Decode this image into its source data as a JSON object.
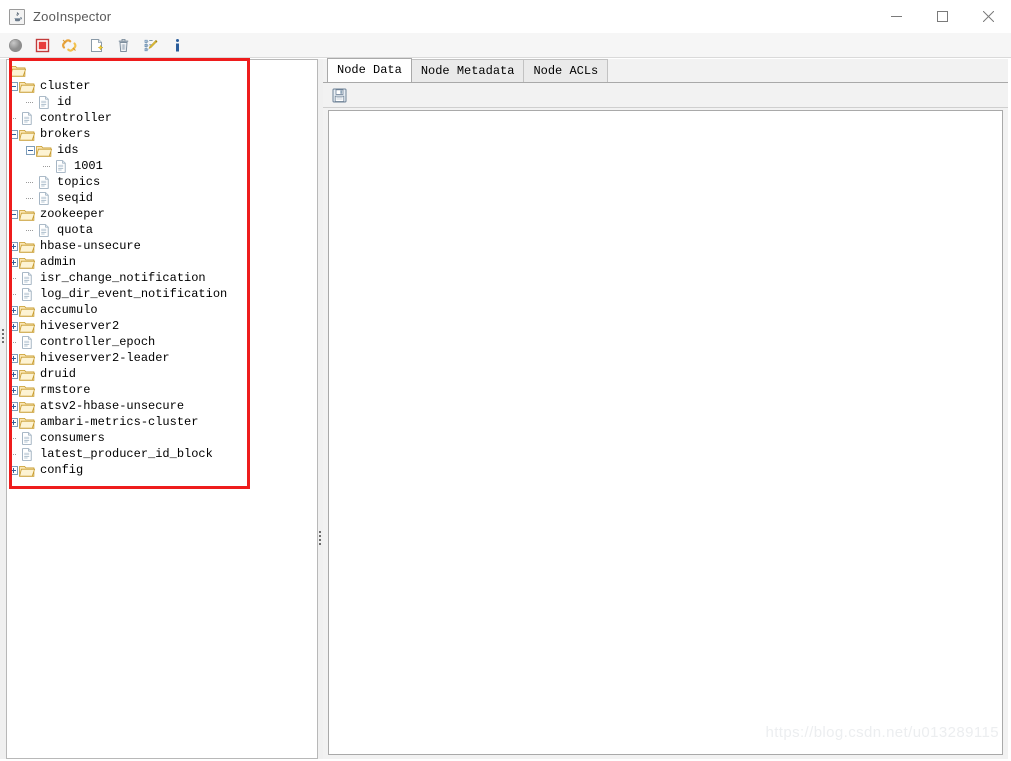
{
  "window": {
    "title": "ZooInspector",
    "app_icon": "java-coffee-cup-icon",
    "controls": {
      "minimize": "—",
      "maximize": "□",
      "close": "✕"
    }
  },
  "toolbar": {
    "buttons": [
      {
        "name": "connect-button",
        "icon": "gray-circle-icon",
        "label": "Connect",
        "enabled": false
      },
      {
        "name": "disconnect-button",
        "icon": "red-square-icon",
        "label": "Disconnect",
        "enabled": true
      },
      {
        "name": "reconnect-button",
        "icon": "yellow-links-icon",
        "label": "Reconnect",
        "enabled": true
      },
      {
        "name": "add-node-button",
        "icon": "new-page-icon",
        "label": "Add Node",
        "enabled": true
      },
      {
        "name": "delete-node-button",
        "icon": "trash-can-icon",
        "label": "Delete Node",
        "enabled": true
      },
      {
        "name": "edit-node-button",
        "icon": "tree-pencil-icon",
        "label": "Edit Node",
        "enabled": true
      },
      {
        "name": "about-button",
        "icon": "info-icon",
        "label": "About",
        "enabled": true
      }
    ]
  },
  "tree": {
    "root": {
      "label": "",
      "icon": "folder-open-icon"
    },
    "nodes": [
      {
        "label": "cluster",
        "icon": "folder-open-icon",
        "depth": 1,
        "toggle": "minus"
      },
      {
        "label": "id",
        "icon": "file-icon",
        "depth": 2,
        "toggle": "none"
      },
      {
        "label": "controller",
        "icon": "file-icon",
        "depth": 1,
        "toggle": "none"
      },
      {
        "label": "brokers",
        "icon": "folder-open-icon",
        "depth": 1,
        "toggle": "minus"
      },
      {
        "label": "ids",
        "icon": "folder-open-icon",
        "depth": 2,
        "toggle": "minus"
      },
      {
        "label": "1001",
        "icon": "file-icon",
        "depth": 3,
        "toggle": "none"
      },
      {
        "label": "topics",
        "icon": "file-icon",
        "depth": 2,
        "toggle": "none"
      },
      {
        "label": "seqid",
        "icon": "file-icon",
        "depth": 2,
        "toggle": "none"
      },
      {
        "label": "zookeeper",
        "icon": "folder-open-icon",
        "depth": 1,
        "toggle": "minus"
      },
      {
        "label": "quota",
        "icon": "file-icon",
        "depth": 2,
        "toggle": "none"
      },
      {
        "label": "hbase-unsecure",
        "icon": "folder-open-icon",
        "depth": 1,
        "toggle": "plus"
      },
      {
        "label": "admin",
        "icon": "folder-open-icon",
        "depth": 1,
        "toggle": "plus"
      },
      {
        "label": "isr_change_notification",
        "icon": "file-icon",
        "depth": 1,
        "toggle": "none"
      },
      {
        "label": "log_dir_event_notification",
        "icon": "file-icon",
        "depth": 1,
        "toggle": "none"
      },
      {
        "label": "accumulo",
        "icon": "folder-open-icon",
        "depth": 1,
        "toggle": "plus"
      },
      {
        "label": "hiveserver2",
        "icon": "folder-open-icon",
        "depth": 1,
        "toggle": "plus"
      },
      {
        "label": "controller_epoch",
        "icon": "file-icon",
        "depth": 1,
        "toggle": "none"
      },
      {
        "label": "hiveserver2-leader",
        "icon": "folder-open-icon",
        "depth": 1,
        "toggle": "plus"
      },
      {
        "label": "druid",
        "icon": "folder-open-icon",
        "depth": 1,
        "toggle": "plus"
      },
      {
        "label": "rmstore",
        "icon": "folder-open-icon",
        "depth": 1,
        "toggle": "plus"
      },
      {
        "label": "atsv2-hbase-unsecure",
        "icon": "folder-open-icon",
        "depth": 1,
        "toggle": "plus"
      },
      {
        "label": "ambari-metrics-cluster",
        "icon": "folder-open-icon",
        "depth": 1,
        "toggle": "plus"
      },
      {
        "label": "consumers",
        "icon": "file-icon",
        "depth": 1,
        "toggle": "none"
      },
      {
        "label": "latest_producer_id_block",
        "icon": "file-icon",
        "depth": 1,
        "toggle": "none"
      },
      {
        "label": "config",
        "icon": "folder-open-icon",
        "depth": 1,
        "toggle": "plus"
      }
    ]
  },
  "detail": {
    "tabs": [
      {
        "label": "Node Data",
        "active": true
      },
      {
        "label": "Node Metadata",
        "active": false
      },
      {
        "label": "Node ACLs",
        "active": false
      }
    ],
    "save_icon": "floppy-disk-save-icon",
    "content": ""
  },
  "annotation": {
    "highlight_color": "#ee1c1c",
    "shape": "rectangle"
  },
  "watermark": {
    "text": "https://blog.csdn.net/u013289115"
  }
}
